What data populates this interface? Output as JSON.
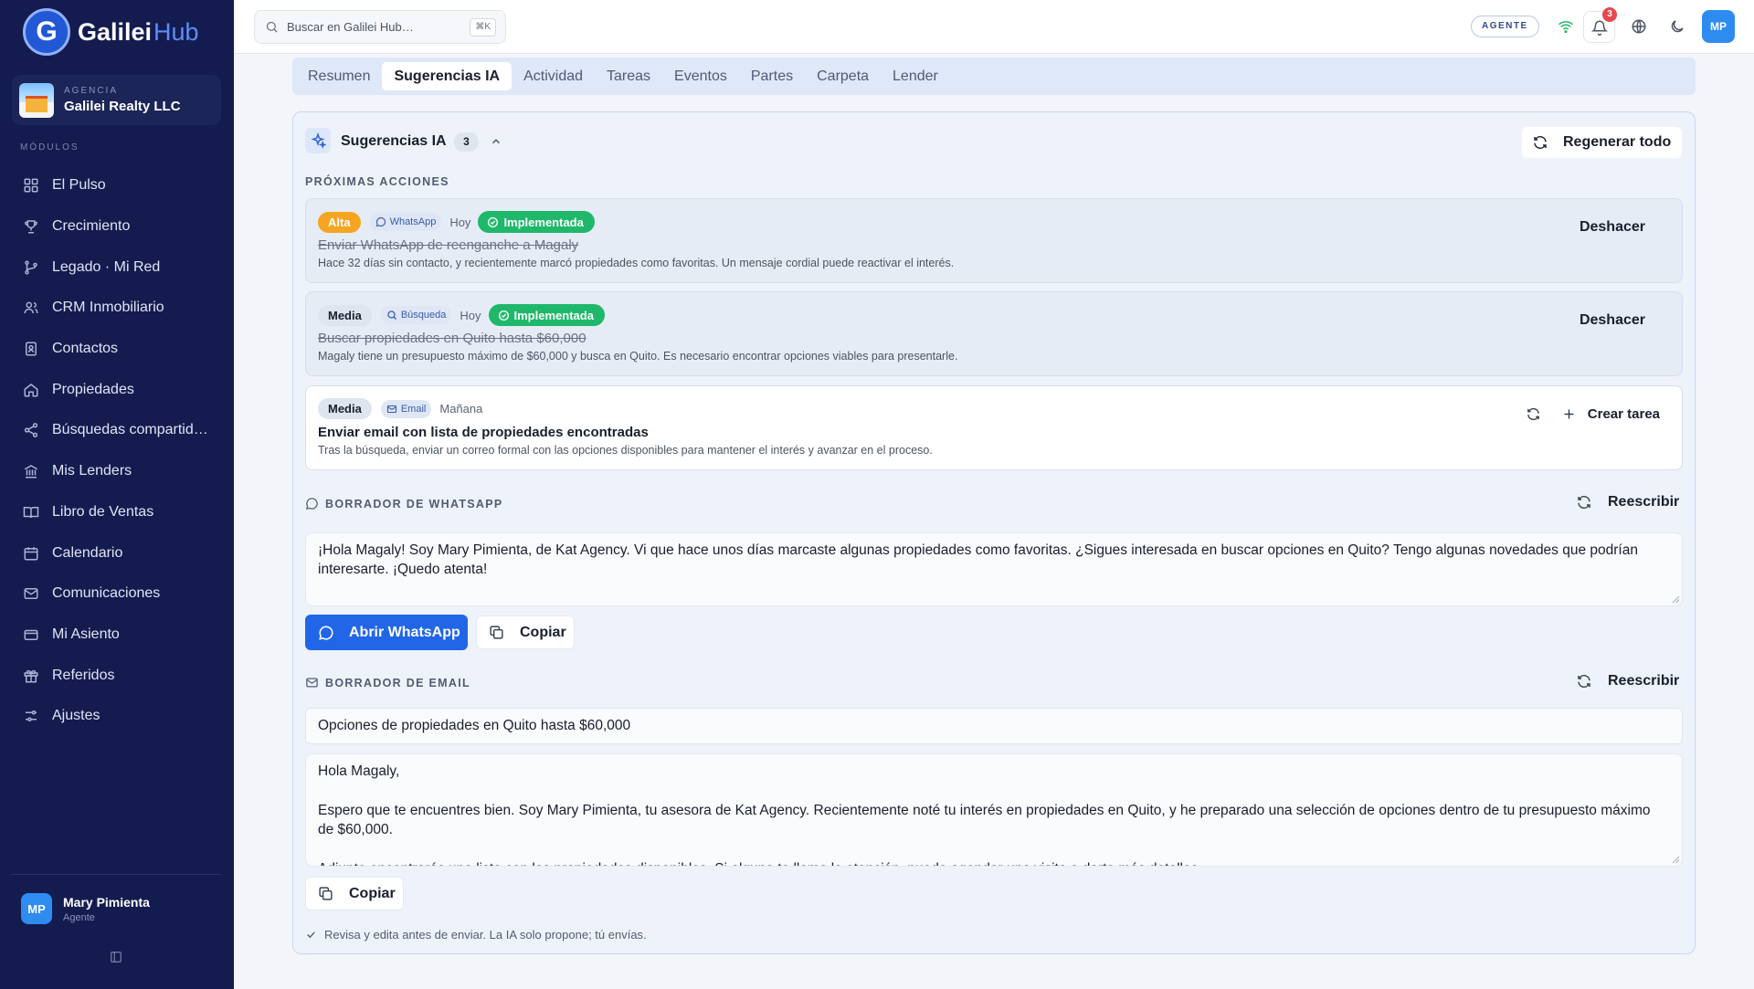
{
  "brand": {
    "name_main": "Galilei",
    "name_suffix": "Hub",
    "logo_letter": "G"
  },
  "agency": {
    "label": "AGENCIA",
    "name": "Galilei Realty LLC"
  },
  "sidebar": {
    "modules_label": "MÓDULOS",
    "items": [
      {
        "label": "El Pulso",
        "icon": "grid-icon"
      },
      {
        "label": "Crecimiento",
        "icon": "trophy-icon"
      },
      {
        "label": "Legado · Mi Red",
        "icon": "git-branch-icon"
      },
      {
        "label": "CRM Inmobiliario",
        "icon": "users-icon"
      },
      {
        "label": "Contactos",
        "icon": "contact-book-icon"
      },
      {
        "label": "Propiedades",
        "icon": "home-icon"
      },
      {
        "label": "Búsquedas compartid…",
        "icon": "share-icon"
      },
      {
        "label": "Mis Lenders",
        "icon": "bank-icon"
      },
      {
        "label": "Libro de Ventas",
        "icon": "book-open-icon"
      },
      {
        "label": "Calendario",
        "icon": "calendar-icon"
      },
      {
        "label": "Comunicaciones",
        "icon": "mail-icon"
      },
      {
        "label": "Mi Asiento",
        "icon": "wallet-icon"
      },
      {
        "label": "Referidos",
        "icon": "gift-icon"
      },
      {
        "label": "Ajustes",
        "icon": "sliders-icon"
      }
    ]
  },
  "user": {
    "initials": "MP",
    "name": "Mary Pimienta",
    "role": "Agente"
  },
  "topbar": {
    "search_placeholder": "Buscar en Galilei Hub…",
    "search_shortcut": "⌘K",
    "role_badge": "AGENTE",
    "notifications_count": "3",
    "avatar_initials": "MP"
  },
  "tabs": [
    {
      "label": "Resumen",
      "active": false
    },
    {
      "label": "Sugerencias IA",
      "active": true
    },
    {
      "label": "Actividad",
      "active": false
    },
    {
      "label": "Tareas",
      "active": false
    },
    {
      "label": "Eventos",
      "active": false
    },
    {
      "label": "Partes",
      "active": false
    },
    {
      "label": "Carpeta",
      "active": false
    },
    {
      "label": "Lender",
      "active": false
    }
  ],
  "suggestions": {
    "title": "Sugerencias IA",
    "count": "3",
    "regenerate_label": "Regenerar todo",
    "next_actions_label": "PRÓXIMAS ACCIONES",
    "actions": [
      {
        "priority": "Alta",
        "channel": "WhatsApp",
        "when": "Hoy",
        "status": "Implementada",
        "title": "Enviar WhatsApp de reenganche a Magaly",
        "description": "Hace 32 días sin contacto, y recientemente marcó propiedades como favoritas. Un mensaje cordial puede reactivar el interés.",
        "undo_label": "Deshacer"
      },
      {
        "priority": "Media",
        "channel": "Búsqueda",
        "when": "Hoy",
        "status": "Implementada",
        "title": "Buscar propiedades en Quito hasta $60,000",
        "description": "Magaly tiene un presupuesto máximo de $60,000 y busca en Quito. Es necesario encontrar opciones viables para presentarle.",
        "undo_label": "Deshacer"
      },
      {
        "priority": "Media",
        "channel": "Email",
        "when": "Mañana",
        "title": "Enviar email con lista de propiedades encontradas",
        "description": "Tras la búsqueda, enviar un correo formal con las opciones disponibles para mantener el interés y avanzar en el proceso.",
        "create_task_label": "Crear tarea"
      }
    ],
    "whatsapp_draft": {
      "label": "BORRADOR DE WHATSAPP",
      "rewrite_label": "Reescribir",
      "text": "¡Hola Magaly! Soy Mary Pimienta, de Kat Agency. Vi que hace unos días marcaste algunas propiedades como favoritas. ¿Sigues interesada en buscar opciones en Quito? Tengo algunas novedades que podrían interesarte. ¡Quedo atenta!",
      "open_label": "Abrir WhatsApp",
      "copy_label": "Copiar"
    },
    "email_draft": {
      "label": "BORRADOR DE EMAIL",
      "rewrite_label": "Reescribir",
      "subject": "Opciones de propiedades en Quito hasta $60,000",
      "greeting": "Hola Magaly,",
      "paragraph_1": "Espero que te encuentres bien. Soy Mary Pimienta, tu asesora de Kat Agency. Recientemente noté tu interés en propiedades en Quito, y he preparado una selección de opciones dentro de tu presupuesto máximo de $60,000.",
      "paragraph_2": "Adjunto encontrarás una lista con las propiedades disponibles. Si alguna te llama la atención, puedo agendar una visita o darte más detalles.",
      "copy_label": "Copiar"
    },
    "footnote": "Revisa y edita antes de enviar. La IA solo propone; tú envías."
  }
}
